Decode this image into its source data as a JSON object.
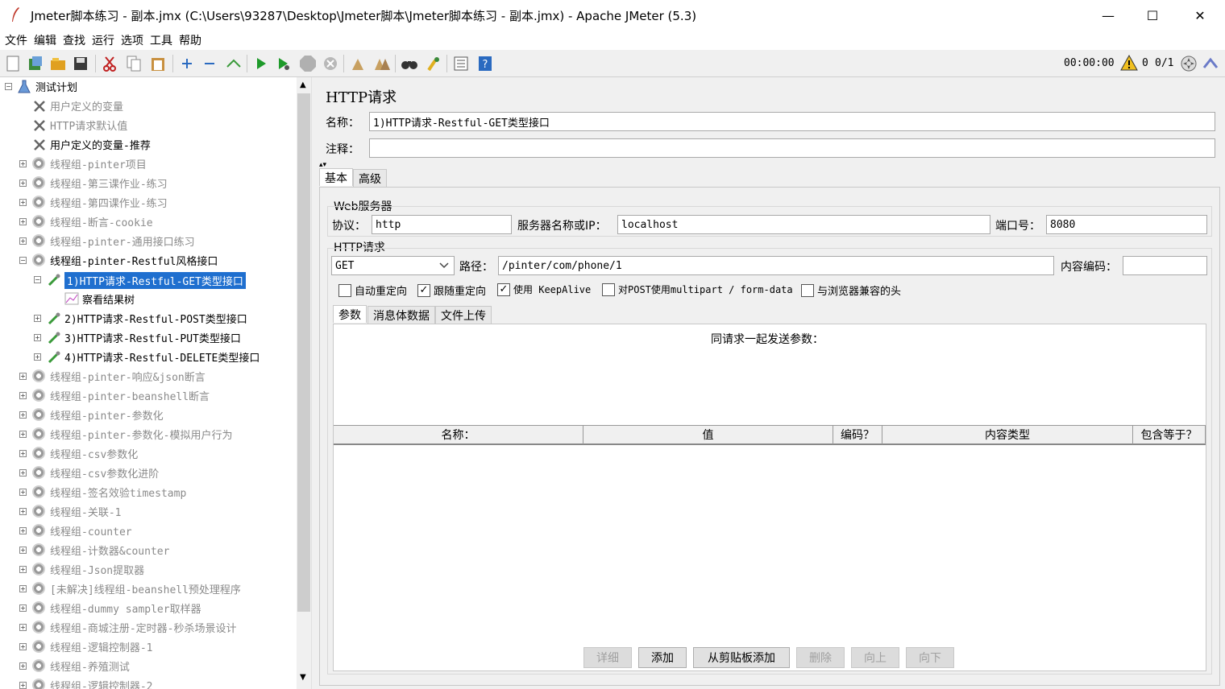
{
  "window": {
    "title": "Jmeter脚本练习 - 副本.jmx (C:\\Users\\93287\\Desktop\\Jmeter脚本\\Jmeter脚本练习 - 副本.jmx) - Apache JMeter (5.3)",
    "minimize": "—",
    "maximize": "☐",
    "close": "✕"
  },
  "menu": [
    "文件",
    "编辑",
    "查找",
    "运行",
    "选项",
    "工具",
    "帮助"
  ],
  "toolbar": {
    "timer": "00:00:00",
    "warnings": "0",
    "threads": "0/1"
  },
  "tree": [
    {
      "label": "测试计划",
      "level": 0,
      "icon": "flask-icon",
      "expander": "minus",
      "style": "normal"
    },
    {
      "label": "用户定义的变量",
      "level": 1,
      "icon": "wrench-icon",
      "expander": "none",
      "style": "gray"
    },
    {
      "label": "HTTP请求默认值",
      "level": 1,
      "icon": "wrench-icon",
      "expander": "none",
      "style": "gray"
    },
    {
      "label": "用户定义的变量-推荐",
      "level": 1,
      "icon": "wrench-icon",
      "expander": "none",
      "style": "normal"
    },
    {
      "label": "线程组-pinter项目",
      "level": 1,
      "icon": "gear-icon",
      "expander": "plus",
      "style": "gray"
    },
    {
      "label": "线程组-第三课作业-练习",
      "level": 1,
      "icon": "gear-icon",
      "expander": "plus",
      "style": "gray"
    },
    {
      "label": "线程组-第四课作业-练习",
      "level": 1,
      "icon": "gear-icon",
      "expander": "plus",
      "style": "gray"
    },
    {
      "label": "线程组-断言-cookie",
      "level": 1,
      "icon": "gear-icon",
      "expander": "plus",
      "style": "gray"
    },
    {
      "label": "线程组-pinter-通用接口练习",
      "level": 1,
      "icon": "gear-icon",
      "expander": "plus",
      "style": "gray"
    },
    {
      "label": "线程组-pinter-Restful风格接口",
      "level": 1,
      "icon": "gear-icon",
      "expander": "minus",
      "style": "normal"
    },
    {
      "label": "1)HTTP请求-Restful-GET类型接口",
      "level": 2,
      "icon": "pipette-icon",
      "expander": "minus",
      "style": "selected"
    },
    {
      "label": "察看结果树",
      "level": 3,
      "icon": "chart-icon",
      "expander": "none",
      "style": "normal"
    },
    {
      "label": "2)HTTP请求-Restful-POST类型接口",
      "level": 2,
      "icon": "pipette-icon",
      "expander": "plus",
      "style": "normal"
    },
    {
      "label": "3)HTTP请求-Restful-PUT类型接口",
      "level": 2,
      "icon": "pipette-icon",
      "expander": "plus",
      "style": "normal"
    },
    {
      "label": "4)HTTP请求-Restful-DELETE类型接口",
      "level": 2,
      "icon": "pipette-icon",
      "expander": "plus",
      "style": "normal"
    },
    {
      "label": "线程组-pinter-响应&json断言",
      "level": 1,
      "icon": "gear-icon",
      "expander": "plus",
      "style": "gray"
    },
    {
      "label": "线程组-pinter-beanshell断言",
      "level": 1,
      "icon": "gear-icon",
      "expander": "plus",
      "style": "gray"
    },
    {
      "label": "线程组-pinter-参数化",
      "level": 1,
      "icon": "gear-icon",
      "expander": "plus",
      "style": "gray"
    },
    {
      "label": "线程组-pinter-参数化-模拟用户行为",
      "level": 1,
      "icon": "gear-icon",
      "expander": "plus",
      "style": "gray"
    },
    {
      "label": "线程组-csv参数化",
      "level": 1,
      "icon": "gear-icon",
      "expander": "plus",
      "style": "gray"
    },
    {
      "label": "线程组-csv参数化进阶",
      "level": 1,
      "icon": "gear-icon",
      "expander": "plus",
      "style": "gray"
    },
    {
      "label": "线程组-签名效验timestamp",
      "level": 1,
      "icon": "gear-icon",
      "expander": "plus",
      "style": "gray"
    },
    {
      "label": "线程组-关联-1",
      "level": 1,
      "icon": "gear-icon",
      "expander": "plus",
      "style": "gray"
    },
    {
      "label": "线程组-counter",
      "level": 1,
      "icon": "gear-icon",
      "expander": "plus",
      "style": "gray"
    },
    {
      "label": "线程组-计数器&counter",
      "level": 1,
      "icon": "gear-icon",
      "expander": "plus",
      "style": "gray"
    },
    {
      "label": "线程组-Json提取器",
      "level": 1,
      "icon": "gear-icon",
      "expander": "plus",
      "style": "gray"
    },
    {
      "label": "[未解决]线程组-beanshell预处理程序",
      "level": 1,
      "icon": "gear-icon",
      "expander": "plus",
      "style": "gray"
    },
    {
      "label": "线程组-dummy sampler取样器",
      "level": 1,
      "icon": "gear-icon",
      "expander": "plus",
      "style": "gray"
    },
    {
      "label": "线程组-商城注册-定时器-秒杀场景设计",
      "level": 1,
      "icon": "gear-icon",
      "expander": "plus",
      "style": "gray"
    },
    {
      "label": "线程组-逻辑控制器-1",
      "level": 1,
      "icon": "gear-icon",
      "expander": "plus",
      "style": "gray"
    },
    {
      "label": "线程组-养殖测试",
      "level": 1,
      "icon": "gear-icon",
      "expander": "plus",
      "style": "gray"
    },
    {
      "label": "线程组-逻辑控制器-2",
      "level": 1,
      "icon": "gear-icon",
      "expander": "plus",
      "style": "gray"
    }
  ],
  "panel": {
    "heading": "HTTP请求",
    "name_label": "名称：",
    "name_value": "1)HTTP请求-Restful-GET类型接口",
    "comment_label": "注释：",
    "comment_value": "",
    "tabs": [
      "基本",
      "高级"
    ],
    "web_server_group": "Web服务器",
    "protocol_label": "协议：",
    "protocol_value": "http",
    "server_label": "服务器名称或IP：",
    "server_value": "localhost",
    "port_label": "端口号：",
    "port_value": "8080",
    "http_group": "HTTP请求",
    "method_value": "GET",
    "path_label": "路径：",
    "path_value": "/pinter/com/phone/1",
    "encoding_label": "内容编码：",
    "encoding_value": "",
    "checkboxes": [
      {
        "label": "自动重定向",
        "checked": false
      },
      {
        "label": "跟随重定向",
        "checked": true
      },
      {
        "label": "使用 KeepAlive",
        "checked": true
      },
      {
        "label": "对POST使用multipart / form-data",
        "checked": false
      },
      {
        "label": "与浏览器兼容的头",
        "checked": false
      }
    ],
    "subtabs": [
      "参数",
      "消息体数据",
      "文件上传"
    ],
    "params_caption": "同请求一起发送参数：",
    "columns": [
      "名称：",
      "值",
      "编码？",
      "内容类型",
      "包含等于？"
    ],
    "buttons": [
      {
        "label": "详细",
        "enabled": false
      },
      {
        "label": "添加",
        "enabled": true
      },
      {
        "label": "从剪贴板添加",
        "enabled": true
      },
      {
        "label": "删除",
        "enabled": false
      },
      {
        "label": "向上",
        "enabled": false
      },
      {
        "label": "向下",
        "enabled": false
      }
    ]
  }
}
